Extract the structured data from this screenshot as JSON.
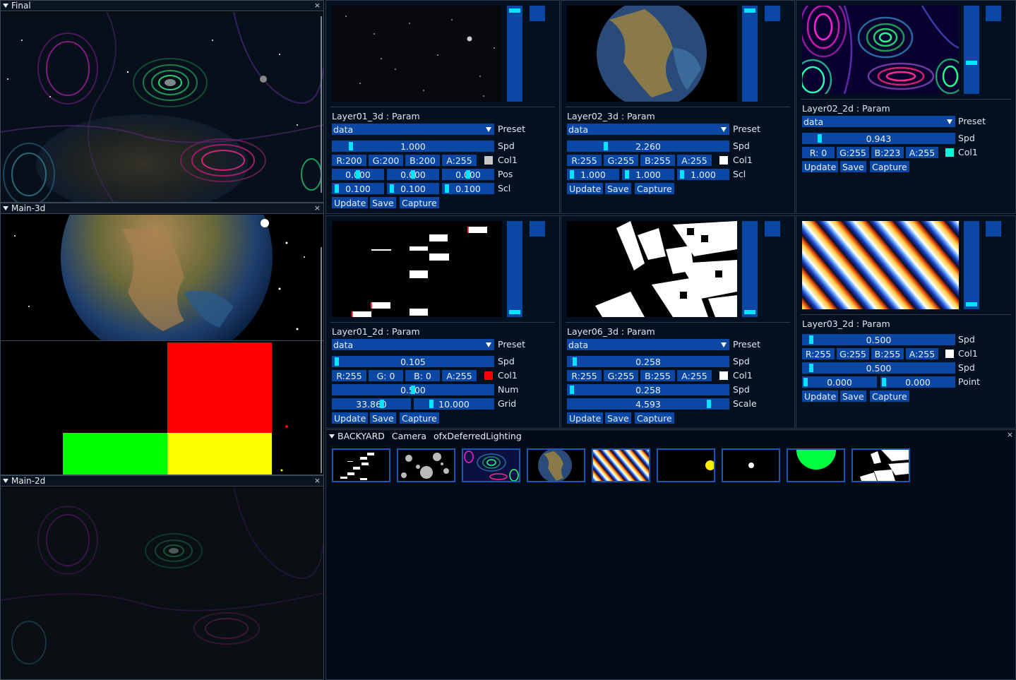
{
  "viewports": {
    "final": {
      "title": "Final"
    },
    "main3d": {
      "title": "Main-3d"
    },
    "main2d": {
      "title": "Main-2d"
    },
    "close_glyph": "×"
  },
  "panels": {
    "layer01_3d": {
      "title": "Layer01_3d : Param",
      "preset_value": "data",
      "preset_label": "Preset",
      "spd_value": "1.000",
      "spd_label": "Spd",
      "col1": {
        "r": "R:200",
        "g": "G:200",
        "b": "B:200",
        "a": "A:255",
        "label": "Col1",
        "swatch": "#c8c8c8"
      },
      "pos": {
        "x": "0.000",
        "y": "0.000",
        "z": "0.000",
        "label": "Pos"
      },
      "scl": {
        "x": "0.100",
        "y": "0.100",
        "z": "0.100",
        "label": "Scl"
      },
      "buttons": {
        "update": "Update",
        "save": "Save",
        "capture": "Capture"
      }
    },
    "layer02_3d": {
      "title": "Layer02_3d : Param",
      "preset_value": "data",
      "preset_label": "Preset",
      "spd_value": "2.260",
      "spd_label": "Spd",
      "col1": {
        "r": "R:255",
        "g": "G:255",
        "b": "B:255",
        "a": "A:255",
        "label": "Col1",
        "swatch": "#ffffff"
      },
      "scl": {
        "x": "1.000",
        "y": "1.000",
        "z": "1.000",
        "label": "Scl"
      },
      "buttons": {
        "update": "Update",
        "save": "Save",
        "capture": "Capture"
      }
    },
    "layer02_2d": {
      "title": "Layer02_2d : Param",
      "preset_value": "data",
      "preset_label": "Preset",
      "spd_value": "0.943",
      "spd_label": "Spd",
      "col1": {
        "r": "R: 0",
        "g": "G:255",
        "b": "B:223",
        "a": "A:255",
        "label": "Col1",
        "swatch": "#00ffdf"
      },
      "buttons": {
        "update": "Update",
        "save": "Save",
        "capture": "Capture"
      }
    },
    "layer01_2d": {
      "title": "Layer01_2d : Param",
      "preset_value": "data",
      "preset_label": "Preset",
      "spd_value": "0.105",
      "spd_label": "Spd",
      "col1": {
        "r": "R:255",
        "g": "G: 0",
        "b": "B: 0",
        "a": "A:255",
        "label": "Col1",
        "swatch": "#ff0000"
      },
      "num_value": "0.500",
      "num_label": "Num",
      "grid": {
        "a": "33.860",
        "b": "10.000",
        "label": "Grid"
      },
      "buttons": {
        "update": "Update",
        "save": "Save",
        "capture": "Capture"
      }
    },
    "layer06_3d": {
      "title": "Layer06_3d : Param",
      "preset_value": "data",
      "preset_label": "Preset",
      "spd_value": "0.258",
      "spd_label": "Spd",
      "col1": {
        "r": "R:255",
        "g": "G:255",
        "b": "B:255",
        "a": "A:255",
        "label": "Col1",
        "swatch": "#ffffff"
      },
      "spd2_value": "0.258",
      "spd2_label": "Spd",
      "scale_value": "4.593",
      "scale_label": "Scale",
      "buttons": {
        "update": "Update",
        "save": "Save",
        "capture": "Capture"
      }
    },
    "layer03_2d": {
      "title": "Layer03_2d : Param",
      "spd_value": "0.500",
      "spd_label": "Spd",
      "col1": {
        "r": "R:255",
        "g": "G:255",
        "b": "B:255",
        "a": "A:255",
        "label": "Col1",
        "swatch": "#ffffff"
      },
      "spd2_value": "0.500",
      "spd2_label": "Spd",
      "point": {
        "x": "0.000",
        "y": "0.000",
        "label": "Point"
      },
      "buttons": {
        "update": "Update",
        "save": "Save",
        "capture": "Capture"
      }
    }
  },
  "backyard": {
    "title": "BACKYARD",
    "menu": [
      "Camera",
      "ofxDeferredLighting"
    ],
    "thumbnails": [
      "layer01-2d",
      "blobs",
      "layer02-2d",
      "earth",
      "stripes",
      "yellow-dot",
      "white-dot",
      "green-circle",
      "checker-tunnel"
    ]
  }
}
